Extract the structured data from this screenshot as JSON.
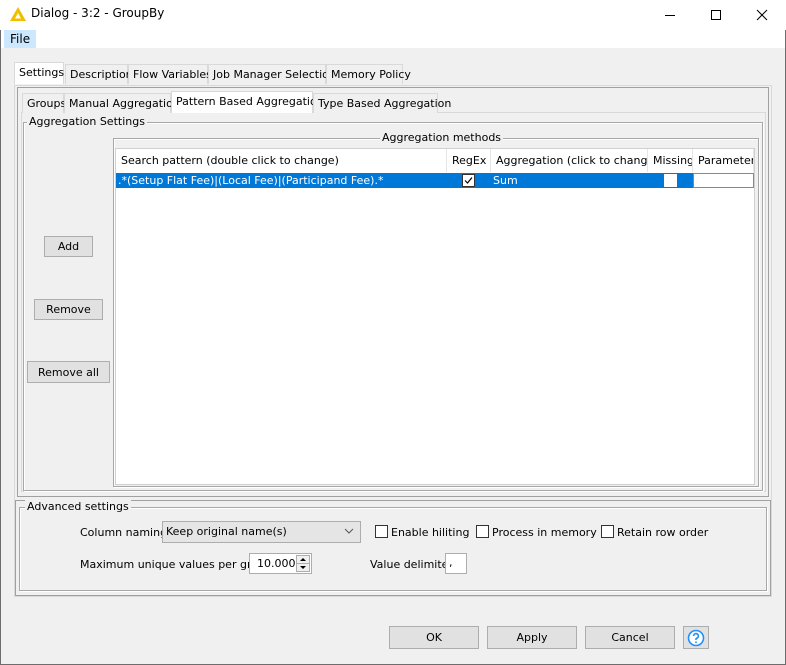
{
  "window": {
    "title": "Dialog - 3:2 - GroupBy",
    "icon": "warning-triangle-icon",
    "controls": [
      "minimize-icon",
      "maximize-icon",
      "close-icon"
    ]
  },
  "menu": {
    "items": [
      {
        "label": "File"
      }
    ]
  },
  "outer_tabs": [
    {
      "label": "Settings",
      "active": true
    },
    {
      "label": "Description",
      "active": false
    },
    {
      "label": "Flow Variables",
      "active": false
    },
    {
      "label": "Job Manager Selection",
      "active": false
    },
    {
      "label": "Memory Policy",
      "active": false
    }
  ],
  "inner_tabs": [
    {
      "label": "Groups",
      "active": false
    },
    {
      "label": "Manual Aggregation",
      "active": false
    },
    {
      "label": "Pattern Based Aggregation",
      "active": true
    },
    {
      "label": "Type Based Aggregation",
      "active": false
    }
  ],
  "aggregation_settings": {
    "legend": "Aggregation Settings",
    "buttons": {
      "add": "Add",
      "remove": "Remove",
      "remove_all": "Remove all"
    },
    "methods": {
      "legend": "Aggregation methods",
      "columns": [
        "Search pattern (double click to change)",
        "RegEx",
        "Aggregation (click to change)",
        "Missing",
        "Parameter"
      ],
      "rows": [
        {
          "pattern": ".*(Setup Flat Fee)|(Local Fee)|(Participand Fee).*",
          "regex": true,
          "aggregation": "Sum",
          "missing": false,
          "parameter": "",
          "selected": true
        }
      ]
    }
  },
  "advanced": {
    "legend": "Advanced settings",
    "column_naming_label": "Column naming:",
    "column_naming_value": "Keep original name(s)",
    "enable_hiliting": {
      "label": "Enable hiliting",
      "checked": false
    },
    "process_in_memory": {
      "label": "Process in memory",
      "checked": false
    },
    "retain_row_order": {
      "label": "Retain row order",
      "checked": false
    },
    "max_unique_label": "Maximum unique values per group",
    "max_unique_value": "10.000",
    "value_delimiter_label": "Value delimiter",
    "value_delimiter_value": ","
  },
  "footer": {
    "ok": "OK",
    "apply": "Apply",
    "cancel": "Cancel",
    "help_icon": "help-icon"
  },
  "colors": {
    "selection": "#0078d7",
    "menu_highlight": "#cce8ff",
    "app_icon": "#f0c000",
    "help_accent": "#1e90ff"
  }
}
